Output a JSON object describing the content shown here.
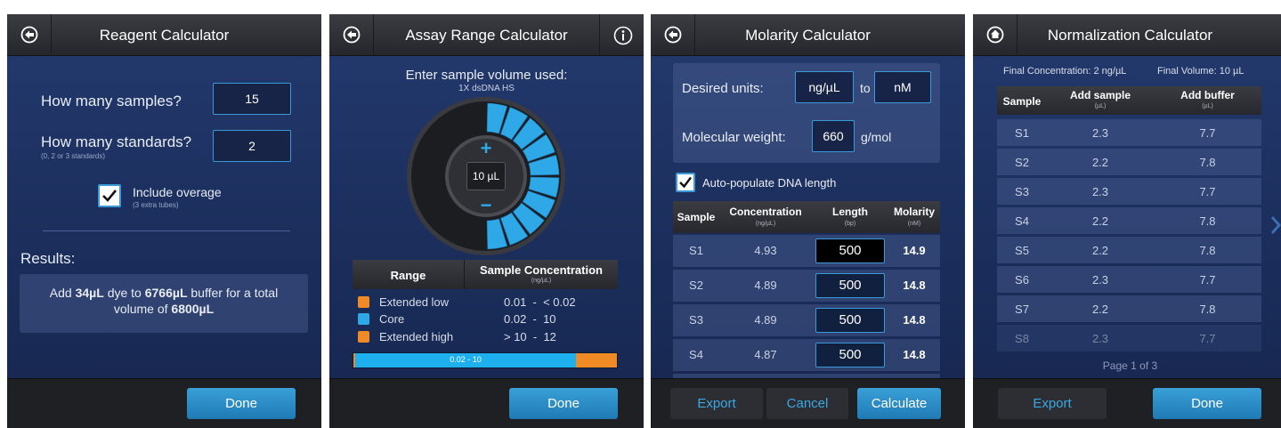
{
  "reagent": {
    "title": "Reagent Calculator",
    "q_samples": "How many samples?",
    "samples_value": "15",
    "q_standards": "How many standards?",
    "standards_hint": "(0, 2 or 3 standards)",
    "standards_value": "2",
    "overage_label": "Include overage",
    "overage_hint": "(3 extra tubes)",
    "results_label": "Results:",
    "result_add": "Add ",
    "result_dye": "34µL",
    "result_mid": " dye to ",
    "result_buffer": "6766µL",
    "result_mid2": " buffer for a total",
    "result_vol_prefix": "volume of ",
    "result_volume": "6800µL",
    "done": "Done"
  },
  "assay": {
    "title": "Assay Range Calculator",
    "prompt": "Enter sample volume used:",
    "assay_name": "1X dsDNA HS",
    "dial_value": "10 µL",
    "plus": "+",
    "minus": "−",
    "col_range": "Range",
    "col_conc": "Sample Concentration",
    "col_conc_unit": "(ng/µL)",
    "ranges": [
      {
        "name": "Extended low",
        "value": "0.01  -  < 0.02",
        "color": "#f08a24"
      },
      {
        "name": "Core",
        "value": "0.02  -  10",
        "color": "#2ea8e6"
      },
      {
        "name": "Extended high",
        "value": "> 10  -  12",
        "color": "#f08a24"
      }
    ],
    "bar_label": "0.02 - 10",
    "done": "Done"
  },
  "molarity": {
    "title": "Molarity Calculator",
    "desired_units": "Desired units:",
    "unit_from": "ng/µL",
    "to": "to",
    "unit_to": "nM",
    "mw_label": "Molecular weight:",
    "mw_value": "660",
    "mw_unit": "g/mol",
    "auto_label": "Auto-populate DNA length",
    "headers": {
      "sample": "Sample",
      "conc": "Concentration",
      "conc_unit": "(ng/µL)",
      "length": "Length",
      "length_unit": "(bp)",
      "molarity": "Molarity",
      "molarity_unit": "(nM)"
    },
    "rows": [
      {
        "sample": "S1",
        "conc": "4.93",
        "length": "500",
        "molarity": "14.9"
      },
      {
        "sample": "S2",
        "conc": "4.89",
        "length": "500",
        "molarity": "14.8"
      },
      {
        "sample": "S3",
        "conc": "4.89",
        "length": "500",
        "molarity": "14.8"
      },
      {
        "sample": "S4",
        "conc": "4.87",
        "length": "500",
        "molarity": "14.8"
      }
    ],
    "export": "Export",
    "cancel": "Cancel",
    "calculate": "Calculate"
  },
  "normalization": {
    "title": "Normalization Calculator",
    "final_conc": "Final Concentration: 2 ng/µL",
    "final_vol": "Final Volume: 10 µL",
    "headers": {
      "sample": "Sample",
      "add_sample": "Add sample",
      "add_sample_unit": "(µL)",
      "add_buffer": "Add buffer",
      "add_buffer_unit": "(µL)"
    },
    "rows": [
      {
        "sample": "S1",
        "add_sample": "2.3",
        "add_buffer": "7.7"
      },
      {
        "sample": "S2",
        "add_sample": "2.2",
        "add_buffer": "7.8"
      },
      {
        "sample": "S3",
        "add_sample": "2.3",
        "add_buffer": "7.7"
      },
      {
        "sample": "S4",
        "add_sample": "2.2",
        "add_buffer": "7.8"
      },
      {
        "sample": "S5",
        "add_sample": "2.2",
        "add_buffer": "7.8"
      },
      {
        "sample": "S6",
        "add_sample": "2.3",
        "add_buffer": "7.7"
      },
      {
        "sample": "S7",
        "add_sample": "2.2",
        "add_buffer": "7.8"
      },
      {
        "sample": "S8",
        "add_sample": "2.3",
        "add_buffer": "7.7"
      }
    ],
    "page": "Page 1 of 3",
    "export": "Export",
    "done": "Done"
  }
}
